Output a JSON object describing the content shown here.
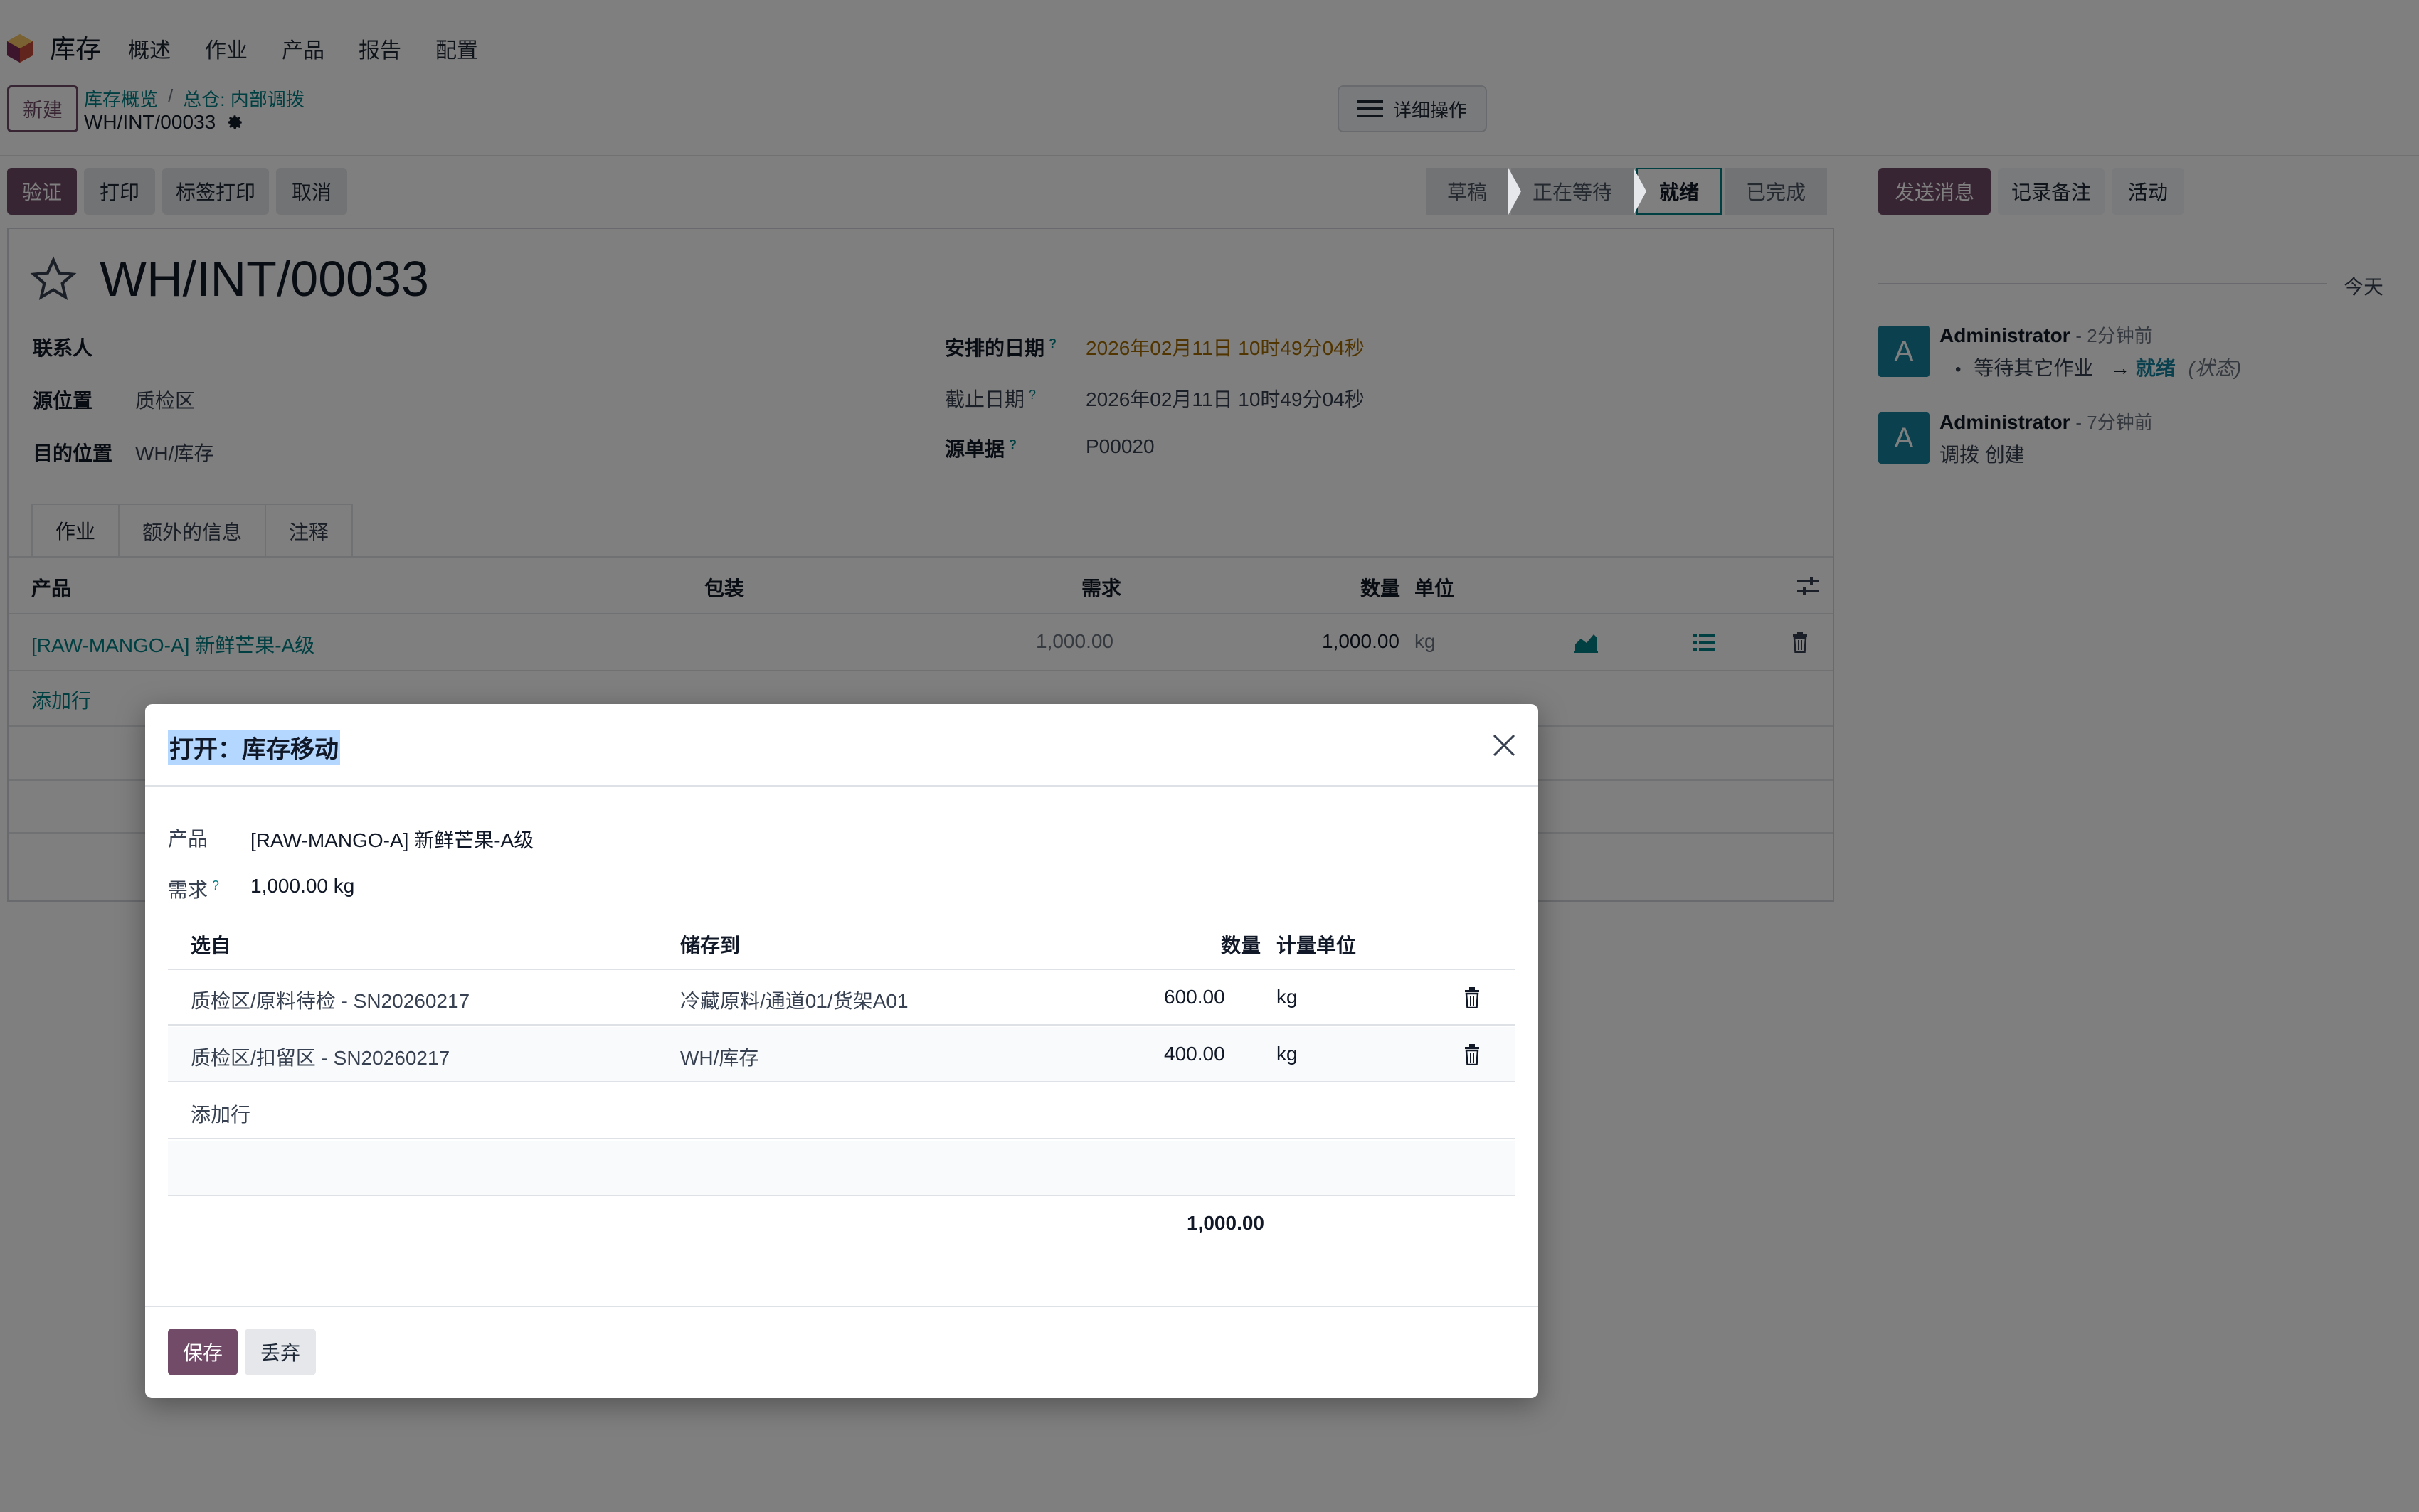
{
  "navbar": {
    "app_name": "库存",
    "menu": [
      "概述",
      "作业",
      "产品",
      "报告",
      "配置"
    ]
  },
  "control_panel": {
    "new_label": "新建",
    "breadcrumb": [
      "库存概览",
      "总仓: 内部调拨"
    ],
    "breadcrumb_sep": "/",
    "record_name": "WH/INT/00033",
    "actions_label": "详细操作"
  },
  "statusbar": {
    "buttons": [
      "验证",
      "打印",
      "标签打印",
      "取消"
    ],
    "stages": [
      "草稿",
      "正在等待",
      "就绪",
      "已完成"
    ],
    "active_stage": "就绪"
  },
  "form": {
    "title": "WH/INT/00033",
    "left_fields": [
      {
        "label": "联系人",
        "value": ""
      },
      {
        "label": "源位置",
        "value": "质检区"
      },
      {
        "label": "目的位置",
        "value": "WH/库存"
      }
    ],
    "right_fields": [
      {
        "label": "安排的日期",
        "value": "2026年02月11日 10时49分04秒",
        "help": "?"
      },
      {
        "label": "截止日期",
        "value": "2026年02月11日 10时49分04秒",
        "help": "?"
      },
      {
        "label": "源单据",
        "value": "P00020",
        "help": "?"
      }
    ],
    "tabs": [
      "作业",
      "额外的信息",
      "注释"
    ],
    "columns": [
      "产品",
      "包装",
      "需求",
      "数量",
      "单位"
    ],
    "row": {
      "product": "[RAW-MANGO-A] 新鲜芒果-A级",
      "demand": "1,000.00",
      "quantity": "1,000.00",
      "unit": "kg"
    },
    "add_line": "添加行"
  },
  "chatter": {
    "buttons": [
      "发送消息",
      "记录备注",
      "活动"
    ],
    "today": "今天",
    "messages": [
      {
        "avatar": "A",
        "author": "Administrator",
        "time": "- 2分钟前",
        "bullet": "等待其它作业",
        "arrow": "→",
        "new_value": "就绪",
        "field": "(状态)"
      },
      {
        "avatar": "A",
        "author": "Administrator",
        "time": "- 7分钟前",
        "body": "调拨 创建"
      }
    ]
  },
  "dialog": {
    "title": "打开：库存移动",
    "product_label": "产品",
    "product_value": "[RAW-MANGO-A] 新鲜芒果-A级",
    "demand_label": "需求",
    "demand_help": "?",
    "demand_value": "1,000.00 kg",
    "columns": [
      "选自",
      "储存到",
      "数量",
      "计量单位"
    ],
    "rows": [
      {
        "from": "质检区/原料待检 - SN20260217",
        "to": "冷藏原料/通道01/货架A01",
        "qty": "600.00",
        "uom": "kg"
      },
      {
        "from": "质检区/扣留区 - SN20260217",
        "to": "WH/库存",
        "qty": "400.00",
        "uom": "kg"
      }
    ],
    "add_line": "添加行",
    "total": "1,000.00",
    "save_label": "保存",
    "discard_label": "丢弃"
  },
  "colors": {
    "primary": "#714b67",
    "link": "#017e84",
    "avatar": "#17839c",
    "date_warning": "#a36a00"
  }
}
